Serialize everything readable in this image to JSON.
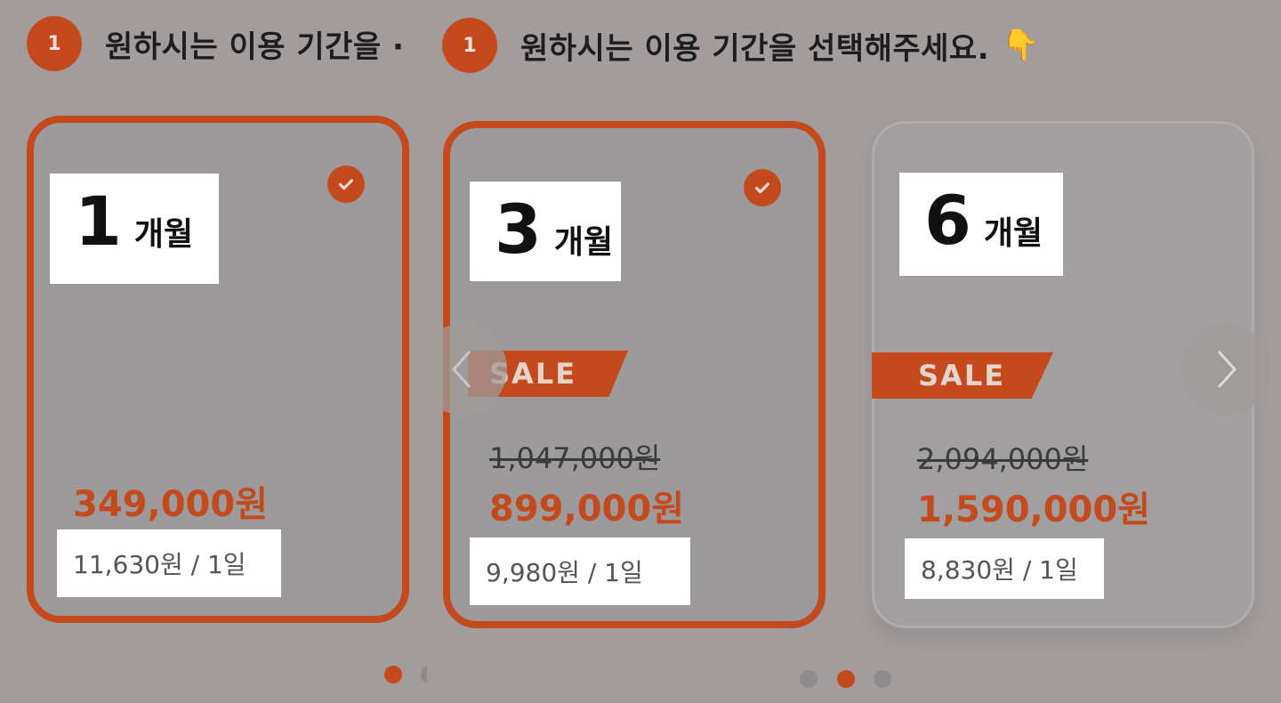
{
  "left": {
    "step": {
      "number": "1",
      "title": "원하시는 이용 기간을 ·"
    },
    "card": {
      "months": "1",
      "unit": "개월",
      "price": "349,000원",
      "daily": "11,630원 / 1일"
    }
  },
  "right": {
    "step": {
      "number": "1",
      "title": "원하시는 이용 기간을 선택해주세요.",
      "emoji": "👇"
    },
    "cards": [
      {
        "months": "3",
        "unit": "개월",
        "sale": "SALE",
        "original_price": "1,047,000원",
        "price": "899,000원",
        "daily": "9,980원 / 1일"
      },
      {
        "months": "6",
        "unit": "개월",
        "sale": "SALE",
        "original_price": "2,094,000원",
        "price": "1,590,000원",
        "daily": "8,830원 / 1일"
      }
    ]
  },
  "icons": {
    "check": "check-circle-icon",
    "prev": "chevron-left-icon",
    "next": "chevron-right-icon"
  },
  "colors": {
    "accent": "#c44a1d",
    "background": "#a29d9c"
  }
}
